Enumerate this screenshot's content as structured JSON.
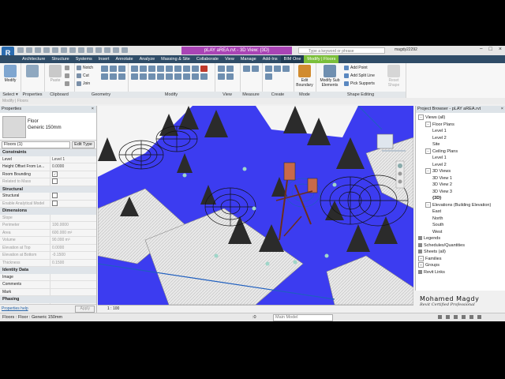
{
  "app": {
    "logo_letter": "R",
    "document_title": "pLAY aREA.rvt - 3D View: {3D}",
    "search_placeholder": "Type a keyword or phrase",
    "user_name": "magdy22292",
    "window_controls": [
      "−",
      "□",
      "×"
    ]
  },
  "ribbon_tabs": [
    {
      "label": "Architecture",
      "active": false
    },
    {
      "label": "Structure",
      "active": false
    },
    {
      "label": "Systems",
      "active": false
    },
    {
      "label": "Insert",
      "active": false
    },
    {
      "label": "Annotate",
      "active": false
    },
    {
      "label": "Analyze",
      "active": false
    },
    {
      "label": "Massing & Site",
      "active": false
    },
    {
      "label": "Collaborate",
      "active": false
    },
    {
      "label": "View",
      "active": false
    },
    {
      "label": "Manage",
      "active": false
    },
    {
      "label": "Add-Ins",
      "active": false
    },
    {
      "label": "BIM One",
      "active": false
    },
    {
      "label": "Modify | Floors",
      "active": true
    }
  ],
  "ribbon": {
    "select_label": "Select ▾",
    "modify_label": "Modify",
    "properties_label": "Properties",
    "paste_label": "Paste",
    "clipboard_label": "Clipboard",
    "notch_label": "Notch",
    "cut_label": "Cut",
    "join_label": "Join",
    "geometry_label": "Geometry",
    "modify_group_label": "Modify",
    "view_label": "View",
    "measure_label": "Measure",
    "create_label": "Create",
    "edit_boundary_label": "Edit Boundary",
    "mode_label": "Mode",
    "modify_sub_label": "Modify Sub Elements",
    "add_point_label": "Add Point",
    "add_split_line_label": "Add Split Line",
    "pick_supports_label": "Pick Supports",
    "reset_shape_label": "Reset Shape",
    "shape_editing_label": "Shape Editing"
  },
  "mode_bar_text": "Modify | Floors",
  "properties": {
    "panel_title": "Properties",
    "type_name": "Floor",
    "type_detail": "Generic 150mm",
    "filter": "Floors (1)",
    "edit_type": "Edit Type",
    "rows": [
      {
        "section": "Constraints"
      },
      {
        "k": "Level",
        "v": "Level 1"
      },
      {
        "k": "Height Offset From Le...",
        "v": "0.0000"
      },
      {
        "k": "Room Bounding",
        "check": true
      },
      {
        "k": "Related to Mass",
        "check": false,
        "grey": true
      },
      {
        "section": "Structural"
      },
      {
        "k": "Structural",
        "check": false
      },
      {
        "k": "Enable Analytical Model",
        "check": false,
        "grey": true
      },
      {
        "section": "Dimensions"
      },
      {
        "k": "Slope",
        "v": "",
        "grey": true
      },
      {
        "k": "Perimeter",
        "v": "100.0000",
        "grey": true
      },
      {
        "k": "Area",
        "v": "600.000 m²",
        "grey": true
      },
      {
        "k": "Volume",
        "v": "90.000 m³",
        "grey": true
      },
      {
        "k": "Elevation at Top",
        "v": "0.0000",
        "grey": true
      },
      {
        "k": "Elevation at Bottom",
        "v": "-0.1500",
        "grey": true
      },
      {
        "k": "Thickness",
        "v": "0.1500",
        "grey": true
      },
      {
        "section": "Identity Data"
      },
      {
        "k": "Image",
        "v": ""
      },
      {
        "k": "Comments",
        "v": ""
      },
      {
        "k": "Mark",
        "v": ""
      },
      {
        "section": "Phasing"
      },
      {
        "k": "Phase Created",
        "v": "New Constru..."
      },
      {
        "k": "Phase Demolished",
        "v": "None"
      }
    ],
    "help_link": "Properties help",
    "apply": "Apply"
  },
  "viewport": {
    "scale": "1 : 100"
  },
  "project_browser": {
    "title": "Project Browser - pLAY aREA.rvt",
    "items": [
      {
        "label": "Views (all)",
        "indent": 0,
        "toggle": "−"
      },
      {
        "label": "Floor Plans",
        "indent": 1,
        "toggle": "−"
      },
      {
        "label": "Level 1",
        "indent": 2
      },
      {
        "label": "Level 2",
        "indent": 2
      },
      {
        "label": "Site",
        "indent": 2
      },
      {
        "label": "Ceiling Plans",
        "indent": 1,
        "toggle": "−"
      },
      {
        "label": "Level 1",
        "indent": 2
      },
      {
        "label": "Level 2",
        "indent": 2
      },
      {
        "label": "3D Views",
        "indent": 1,
        "toggle": "−"
      },
      {
        "label": "3D View 1",
        "indent": 2
      },
      {
        "label": "3D View 2",
        "indent": 2
      },
      {
        "label": "3D View 3",
        "indent": 2
      },
      {
        "label": "{3D}",
        "indent": 2,
        "bold": true
      },
      {
        "label": "Elevations (Building Elevation)",
        "indent": 1,
        "toggle": "−"
      },
      {
        "label": "East",
        "indent": 2
      },
      {
        "label": "North",
        "indent": 2
      },
      {
        "label": "South",
        "indent": 2
      },
      {
        "label": "West",
        "indent": 2
      },
      {
        "label": "Legends",
        "indent": 0,
        "icon": true
      },
      {
        "label": "Schedules/Quantities",
        "indent": 0,
        "icon": true
      },
      {
        "label": "Sheets (all)",
        "indent": 0,
        "icon": true
      },
      {
        "label": "Families",
        "indent": 0,
        "toggle": "+"
      },
      {
        "label": "Groups",
        "indent": 0,
        "toggle": "+"
      },
      {
        "label": "Revit Links",
        "indent": 0,
        "icon": true
      }
    ]
  },
  "watermark": {
    "name": "Mohamed Magdy",
    "subtitle": "Revit Certified Professional"
  },
  "status_bar": {
    "text": "Floors : Floor : Generic 150mm",
    "zero": ":0",
    "model": "Main Model"
  },
  "colors": {
    "title_accent": "#a944b5",
    "tab_bar": "#2f4c67",
    "active_tab": "#7bbf3a",
    "viewport_floor": "#3c3cf0",
    "selection_blue": "#1f5fbf"
  }
}
